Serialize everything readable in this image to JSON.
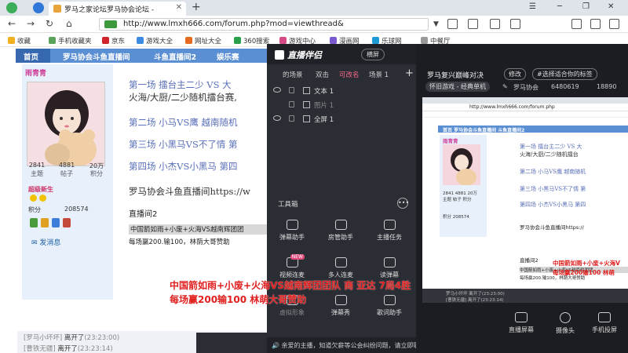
{
  "browser": {
    "tab_title": "罗马之家论坛罗马协会论坛 -",
    "url": "http://www.lmxh666.com/forum.php?mod=viewthread&",
    "bookmarks": [
      "收藏",
      "手机收藏夹",
      "京东",
      "游戏大全",
      "网址大全",
      "360搜索",
      "游戏中心",
      "漫画网",
      "乐球网",
      "中餐厅"
    ]
  },
  "forum": {
    "nav": [
      "首页",
      "罗马协会斗鱼直播间",
      "斗鱼直播间2",
      "娱乐赛"
    ],
    "username": "雨青青",
    "stats": [
      {
        "value": "2841",
        "label": "主题"
      },
      {
        "value": "4881",
        "label": "帖子"
      },
      {
        "value": "20万",
        "label": "积分"
      }
    ],
    "rank": "超级新生",
    "points_label": "积分",
    "points_value": "208574",
    "pm_link": "发消息",
    "post_lines": [
      "第一场    擂台主二少  VS  大",
      "火海/大厨/二少随机擂台赛,",
      "第二场    小马VS鹰   越南随机",
      "第三场    小黑马VS不了情    第",
      "第四场   小杰VS小黑马    第四"
    ],
    "post_link_line": "罗马协会斗鱼直播间https://w",
    "post_room2": "直播间2",
    "post_highlight": "中国箭如雨+小废+火海VS越南辉团团",
    "post_prize": "每场赢200.输100，林荫大哥赞助",
    "chat_log": [
      {
        "name": "[罗马小坏坏]",
        "action": "离开了",
        "time": "(23:23:00)"
      },
      {
        "name": "[曹铁无疆]",
        "action": "离开了",
        "time": "(23:23:14)"
      }
    ]
  },
  "live_panel": {
    "app_name": "直播伴侣",
    "mode_button": "横屏",
    "scene_tabs": [
      "的场景",
      "双击",
      "可改名",
      "场景 1"
    ],
    "active_scene_index": 2,
    "sources": [
      "文本 1",
      "图片 1",
      "全屏 1"
    ],
    "tools_label": "工具箱",
    "tools": [
      {
        "label": "弹幕助手",
        "icon": "danmaku-icon",
        "new": false
      },
      {
        "label": "房管助手",
        "icon": "admin-icon",
        "new": false
      },
      {
        "label": "主播任务",
        "icon": "task-icon",
        "new": false
      },
      {
        "label": "视频连麦",
        "icon": "video-link-icon",
        "new": true
      },
      {
        "label": "多人连麦",
        "icon": "multi-link-icon",
        "new": false
      },
      {
        "label": "读弹幕",
        "icon": "read-danmaku-icon",
        "new": false
      },
      {
        "label": "虚拟形象",
        "icon": "avatar-icon",
        "new": false
      },
      {
        "label": "弹幕秀",
        "icon": "danmaku-show-icon",
        "new": false
      },
      {
        "label": "歌词助手",
        "icon": "lyrics-icon",
        "new": false
      }
    ],
    "footer_notice": "亲爱的主播，知道欠薪等公会纠纷问题，请立即联系专职客服"
  },
  "right_panel": {
    "title": "罗马复兴巅峰对决",
    "edit_button": "修改",
    "tag_prompt": "#选择适合你的标签",
    "category_chip": "怀旧游戏 - 经典单机",
    "edit_icon_label": "✎",
    "org": "罗马协会",
    "room_id": "6480619",
    "fans": "18890",
    "controls": [
      "直播屏幕",
      "摄像头",
      "手机投屏"
    ]
  },
  "overlay": {
    "line1": "中国箭如雨+小废+火海VS越南辉团团队 商 亚达 7局4胜",
    "line2": "每场赢200输100 林萌大哥赞助"
  },
  "preview": {
    "url": "http://www.lmxh666.com/forum.php",
    "nav": "首页   罗马协会斗鱼直播间   斗鱼直播间2",
    "username": "雨青青",
    "stats": "2841   4881   20万",
    "stats_labels": "主题   帖子   积分",
    "points": "积分     208574",
    "lines": [
      "第一场    擂台主二少  VS  大",
      "火海/大厨/二少随机擂台",
      "第二场    小马VS鹰   越南随机",
      "第三场    小黑马VS不了情    第",
      "第四场   小杰VS小黑马    第四"
    ],
    "link_line": "罗马协会斗鱼直播间https://",
    "room2": "直播间2",
    "highlight": "中国箭如雨+小废+火海VS越南辉团团",
    "prize": "每场赢200.输100，林荫大哥赞助",
    "red1": "中国箭如雨+小废+火海V",
    "red2": "每场赢200输100 林萌",
    "log1": "罗马小坏坏  离开了(23:23:00)",
    "log2": "[曹铁无疆] 离开了(23:23:14)"
  }
}
